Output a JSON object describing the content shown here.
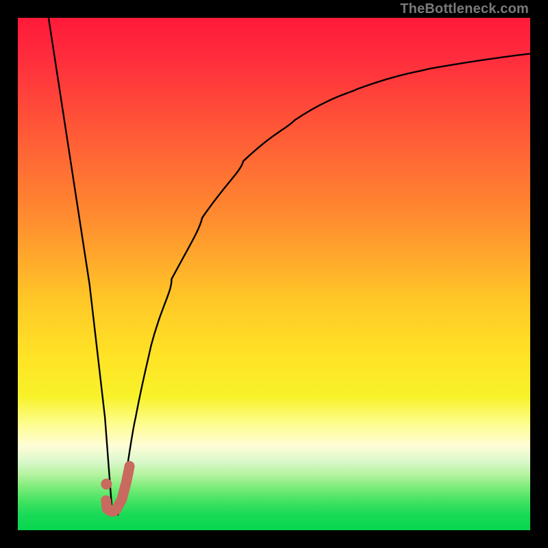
{
  "watermark": "TheBottleneck.com",
  "colors": {
    "frame": "#000000",
    "curve": "#000000",
    "marker": "#c86a5f"
  },
  "chart_data": {
    "type": "line",
    "title": "",
    "xlabel": "",
    "ylabel": "",
    "xlim": [
      0,
      100
    ],
    "ylim": [
      0,
      100
    ],
    "grid": false,
    "annotations": [
      "TheBottleneck.com"
    ],
    "background_gradient_meaning": "red = high bottleneck, green = no bottleneck",
    "series": [
      {
        "name": "left-branch",
        "x": [
          6,
          10,
          14,
          17,
          18.3
        ],
        "y": [
          100,
          74,
          48,
          22,
          5
        ]
      },
      {
        "name": "right-branch",
        "x": [
          19.5,
          21,
          23,
          26,
          30,
          36,
          44,
          54,
          66,
          80,
          100
        ],
        "y": [
          3,
          10,
          22,
          36,
          49,
          61,
          72,
          80,
          86,
          90,
          93
        ]
      }
    ],
    "marker": {
      "name": "J-shaped-indicator",
      "color": "#c86a5f",
      "dot": {
        "x": 17.3,
        "y": 9
      },
      "hook_path": [
        {
          "x": 21.8,
          "y": 12.5
        },
        {
          "x": 21.2,
          "y": 9.5
        },
        {
          "x": 20.3,
          "y": 6
        },
        {
          "x": 19.2,
          "y": 4
        },
        {
          "x": 18.2,
          "y": 3.4
        },
        {
          "x": 17.4,
          "y": 4.2
        },
        {
          "x": 17.2,
          "y": 5.8
        }
      ]
    }
  }
}
